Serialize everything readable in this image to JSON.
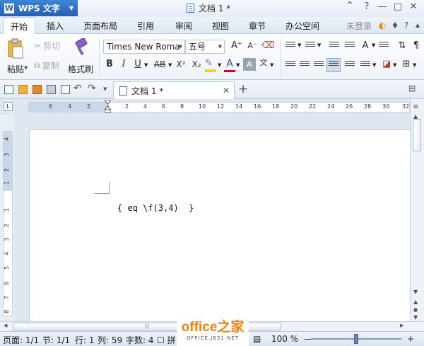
{
  "app": {
    "name": "WPS 文字",
    "logo": "W",
    "doc_title": "文档 1 *"
  },
  "window_controls": {
    "help": "?",
    "minimize": "—",
    "maximize": "□",
    "close": "✕"
  },
  "menu": {
    "tabs": [
      "开始",
      "插入",
      "页面布局",
      "引用",
      "审阅",
      "视图",
      "章节",
      "办公空间"
    ],
    "login": "未登录"
  },
  "ribbon": {
    "paste": "粘贴",
    "cut": "剪切",
    "copy": "复制",
    "format_painter": "格式刷",
    "font_name": "Times New Roma",
    "font_size": "五号",
    "bold": "B",
    "italic": "I",
    "underline": "U",
    "strikethrough": "AB",
    "superscript": "X²",
    "subscript": "X₂",
    "font_color": "A",
    "grow_font": "A⁺",
    "shrink_font": "A⁻",
    "pinyin": "文"
  },
  "doc_tab": {
    "title": "文档 1 *",
    "close": "✕",
    "new": "+"
  },
  "ruler": {
    "h_numbers": [
      "6",
      "4",
      "2",
      "2",
      "4",
      "6",
      "8",
      "10",
      "12",
      "14",
      "16",
      "18",
      "20",
      "22",
      "24",
      "26",
      "28",
      "30",
      "32"
    ],
    "v_numbers": [
      "4",
      "3",
      "2",
      "1",
      "1",
      "2",
      "3",
      "4",
      "5",
      "6",
      "7",
      "8"
    ]
  },
  "document": {
    "field_code": "{ eq \\f(3,4)  }"
  },
  "statusbar": {
    "page": "页面: 1/1",
    "section": "节: 1/1",
    "line": "行: 1",
    "column": "列: 59",
    "word_count": "字数: 4",
    "spellcheck": "拼",
    "zoom": "100 %",
    "zoom_minus": "—",
    "zoom_plus": "+",
    "zoom_level": 0.5
  },
  "watermark": {
    "brand": "office之家",
    "site": "OFFICE.JB51.NET"
  },
  "colors": {
    "accent": "#2a63b6",
    "highlight": "#f5d400",
    "font_color_bar": "#d0021b",
    "watermark": "#e8851a"
  }
}
